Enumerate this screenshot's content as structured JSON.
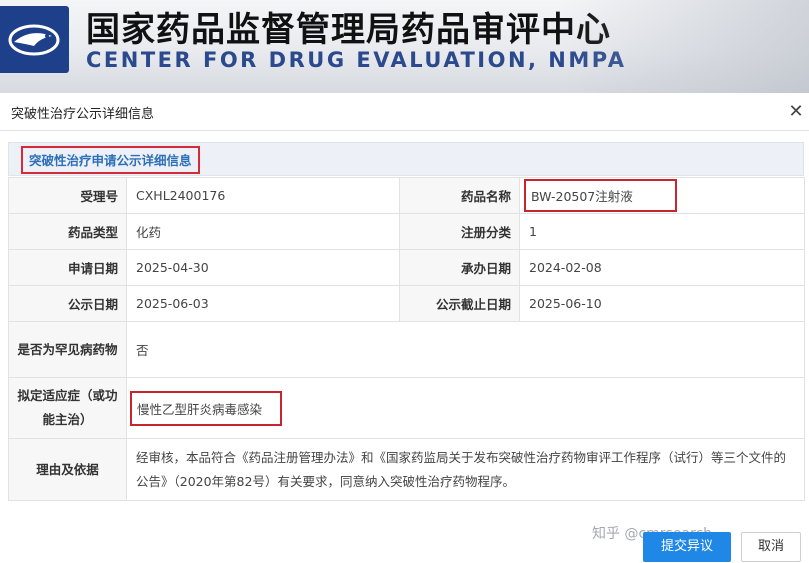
{
  "banner": {
    "title_cn": "国家药品监督管理局药品审评中心",
    "title_en": "CENTER FOR DRUG EVALUATION, NMPA"
  },
  "modal": {
    "title": "突破性治疗公示详细信息",
    "close_icon": "close-icon",
    "section_title": "突破性治疗申请公示详细信息"
  },
  "details": {
    "acceptance_no_label": "受理号",
    "acceptance_no": "CXHL2400176",
    "drug_name_label": "药品名称",
    "drug_name": "BW-20507注射液",
    "drug_type_label": "药品类型",
    "drug_type": "化药",
    "reg_class_label": "注册分类",
    "reg_class": "1",
    "apply_date_label": "申请日期",
    "apply_date": "2025-04-30",
    "handle_date_label": "承办日期",
    "handle_date": "2024-02-08",
    "publish_date_label": "公示日期",
    "publish_date": "2025-06-03",
    "publish_end_label": "公示截止日期",
    "publish_end": "2025-06-10",
    "rare_disease_label": "是否为罕见病药物",
    "rare_disease": "否",
    "indication_label": "拟定适应症（或功能主治）",
    "indication": "慢性乙型肝炎病毒感染",
    "reason_label": "理由及依据",
    "reason": "经审核，本品符合《药品注册管理办法》和《国家药监局关于发布突破性治疗药物审评工作程序（试行）等三个文件的公告》（2020年第82号）有关要求，同意纳入突破性治疗药物程序。"
  },
  "footer": {
    "watermark": "知乎 @cmrsearch",
    "submit_label": "提交异议",
    "cancel_label": "取消"
  },
  "colors": {
    "accent_blue": "#1f87e5",
    "section_text": "#2d6fb8",
    "highlight_red": "#c9242e",
    "logo_blue": "#1e3f8a"
  }
}
